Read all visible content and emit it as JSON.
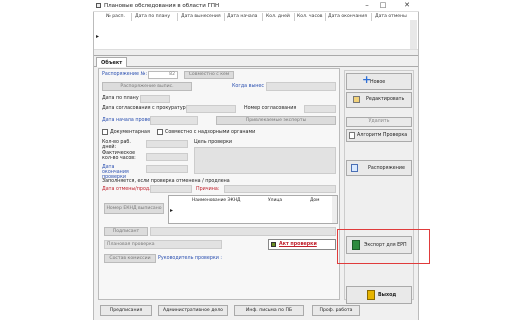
{
  "window": {
    "title": "Плановые обследования в области ГПН",
    "minimize": "–",
    "maximize": "□",
    "close": "✕"
  },
  "grid": {
    "columns": [
      "№ расп.",
      "Дата по плану",
      "Дата вынесения",
      "Дата начала",
      "Кол. дней",
      "Кол. часов",
      "Дата окончания",
      "Дата отмены"
    ],
    "row_marker": "▸"
  },
  "tab": {
    "label": "Объект"
  },
  "form": {
    "order_label": "Распоряжение №:",
    "order_num_value": "82",
    "agree_button": "Совместно с кем",
    "order_button": "Распоряжение выпис.",
    "issued_label": "Когда вынес",
    "date_plan_label": "Дата по плану :",
    "date_prosecutor_label": "Дата согласования с прокуратурой:",
    "agreement_num_label": "Номер согласования",
    "date_start_label": "Дата начала проверки",
    "experts_button": "Привлекаемые эксперты",
    "documentary_label": "Документарная",
    "jointly_label": "Совместно с надзорными органами",
    "workdays_label": "Кол-во раб. дней:",
    "goal_label": "Цель проверки",
    "actual_hours_label": "Фактическое кол-во часов:",
    "end_date_label": "Дата окончания проверки",
    "fill_note": "Заполняется, если проверка отменена / продлена",
    "cancel_date_label": "Дата отмены/продл. :",
    "reason_label": "Причина:",
    "subgrid_cols": [
      "Наименование ЭКНД",
      "Улица",
      "Дом"
    ],
    "subgrid_marker": "▸",
    "eknd_button": "Номер ЕКНД выписано",
    "signed_button": "Подписант",
    "type_value": "Плановая проверка",
    "act_button": "Акт проверки",
    "commission_button": "Состав комиссии",
    "head_label": "Руководитель проверки :"
  },
  "actions": {
    "new": "Новое",
    "edit": "Редактировать",
    "delete": "Удалить",
    "algorithm": "Алгоритм Проверка",
    "order": "Распоряжение",
    "export": "Экспорт для ЕРП",
    "exit": "Выход"
  },
  "bottom": {
    "warning": "Предписания",
    "admin": "Административное дело",
    "info": "Инф. письма по ПБ",
    "prof": "Проф. работа"
  },
  "colors": {
    "accent_red": "#e03b3b",
    "label_blue": "#2a4fb0"
  }
}
